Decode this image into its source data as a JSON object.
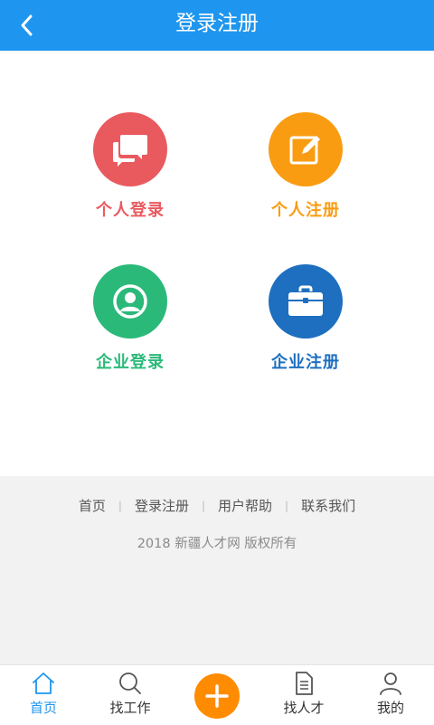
{
  "header": {
    "title": "登录注册",
    "back_icon": "chevron-left-icon",
    "background": "#1e96ef"
  },
  "entries": [
    {
      "label": "个人登录",
      "icon": "chat-bubbles-icon",
      "color": "#e95a5f"
    },
    {
      "label": "个人注册",
      "icon": "edit-icon",
      "color": "#f99c12"
    },
    {
      "label": "企业登录",
      "icon": "user-circle-icon",
      "color": "#2bb97a"
    },
    {
      "label": "企业注册",
      "icon": "briefcase-icon",
      "color": "#1e6fbf"
    }
  ],
  "footer": {
    "links": [
      "首页",
      "登录注册",
      "用户帮助",
      "联系我们"
    ],
    "copyright": "2018 新疆人才网 版权所有"
  },
  "tabbar": {
    "accent": "#1e96ef",
    "add_color": "#ff8c00",
    "tabs": [
      {
        "label": "首页",
        "icon": "home-icon",
        "active": true
      },
      {
        "label": "找工作",
        "icon": "search-icon",
        "active": false
      },
      {
        "label": "",
        "icon": "plus-icon",
        "active": false
      },
      {
        "label": "找人才",
        "icon": "document-icon",
        "active": false
      },
      {
        "label": "我的",
        "icon": "user-icon",
        "active": false
      }
    ]
  }
}
